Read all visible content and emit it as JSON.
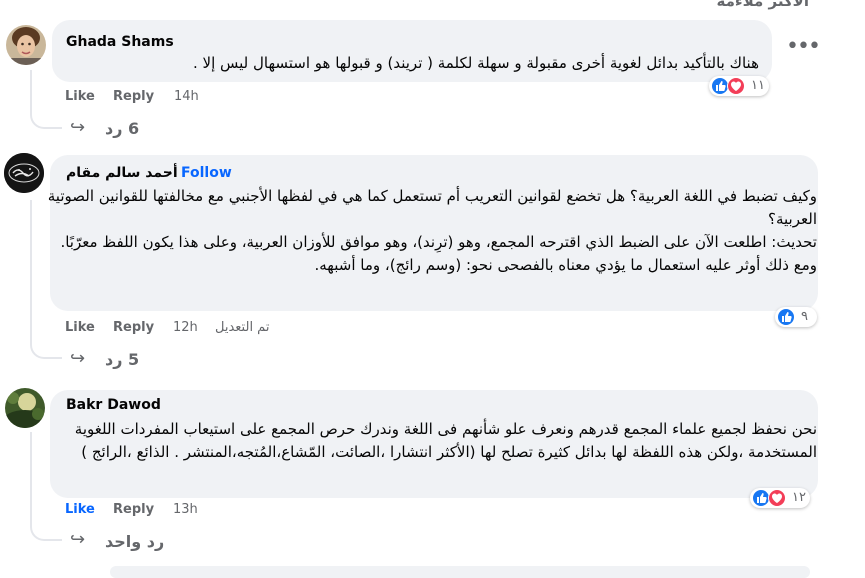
{
  "sort_label": "الأكثر ملاءمة",
  "comments": [
    {
      "author": "Ghada Shams",
      "text": "هناك بالتأكيد بدائل لغوية أخرى مقبولة و سهلة لكلمة ( تريند) و قبولها هو استسهال ليس إلا .",
      "like": "Like",
      "reply": "Reply",
      "time": "14h",
      "reaction_count": "١١",
      "replies": "6 رد"
    },
    {
      "author": "أحمد سالم مقام",
      "follow": "Follow",
      "text": "وكيف تضبط في اللغة العربية؟ هل تخضع لقوانين التعريب أم تستعمل كما هي في لفظها الأجنبي مع مخالفتها للقوانين الصوتية العربية؟\nتحديث: اطلعت الآن على الضبط الذي اقترحه المجمع، وهو (ترِند)، وهو موافق للأوزان العربية، وعلى هذا يكون اللفظ معرّبًا.\nومع ذلك أوثر عليه استعمال ما يؤدي معناه بالفصحى نحو: (وسم رائج)، وما أشبهه.",
      "like": "Like",
      "reply": "Reply",
      "time": "12h",
      "edited": "تم التعديل",
      "reaction_count": "٩",
      "replies": "5 رد"
    },
    {
      "author": "Bakr Dawod",
      "text": "نحن نحفظ لجميع علماء المجمع قدرهم ونعرف علو شأنهم فى اللغة وندرك حرص المجمع على استيعاب المفردات اللغوية المستخدمة ،ولكن هذه اللفظة لها بدائل كثيرة تصلح لها (الأكثر انتشارا ،الصائت، المّشاع،المُتجه،المنتشر . الذائع ،الرائج )",
      "like": "Like",
      "reply": "Reply",
      "time": "13h",
      "reaction_count": "١٢",
      "replies": "رد واحد"
    }
  ],
  "colors": {
    "link_blue": "#0866ff",
    "bubble_bg": "#f0f2f5",
    "secondary_text": "#65676b",
    "like_icon": "#1877f2",
    "love_icon": "#f33e58"
  }
}
